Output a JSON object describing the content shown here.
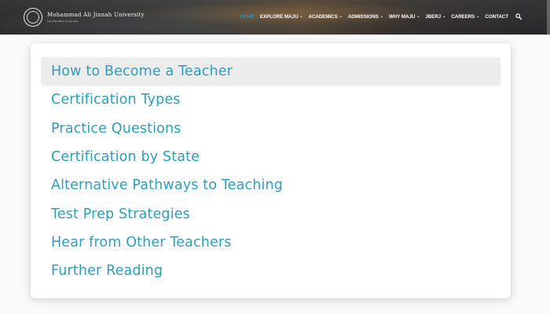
{
  "header": {
    "logo_name": "Mohammad Ali Jinnah University",
    "logo_tagline": "Link Education to Success",
    "nav": [
      {
        "label": "HOME",
        "active": true,
        "dropdown": false
      },
      {
        "label": "EXPLORE MAJU",
        "active": false,
        "dropdown": true
      },
      {
        "label": "ACADEMICS",
        "active": false,
        "dropdown": true
      },
      {
        "label": "ADMISSIONS",
        "active": false,
        "dropdown": true
      },
      {
        "label": "WHY MAJU",
        "active": false,
        "dropdown": true
      },
      {
        "label": "JBERJ",
        "active": false,
        "dropdown": true
      },
      {
        "label": "CAREERS",
        "active": false,
        "dropdown": true
      },
      {
        "label": "CONTACT",
        "active": false,
        "dropdown": false
      }
    ],
    "search_icon": "search-icon",
    "caret_glyph": "⌄"
  },
  "toc": {
    "items": [
      {
        "label": "How to Become a Teacher",
        "highlighted": true
      },
      {
        "label": "Certification Types",
        "highlighted": false
      },
      {
        "label": "Practice Questions",
        "highlighted": false
      },
      {
        "label": "Certification by State",
        "highlighted": false
      },
      {
        "label": "Alternative Pathways to Teaching",
        "highlighted": false
      },
      {
        "label": "Test Prep Strategies",
        "highlighted": false
      },
      {
        "label": "Hear from Other Teachers",
        "highlighted": false
      },
      {
        "label": "Further Reading",
        "highlighted": false
      }
    ]
  },
  "colors": {
    "link": "#2c9fbe",
    "nav_active": "#29a3d4",
    "highlight_bg": "#ececec"
  }
}
